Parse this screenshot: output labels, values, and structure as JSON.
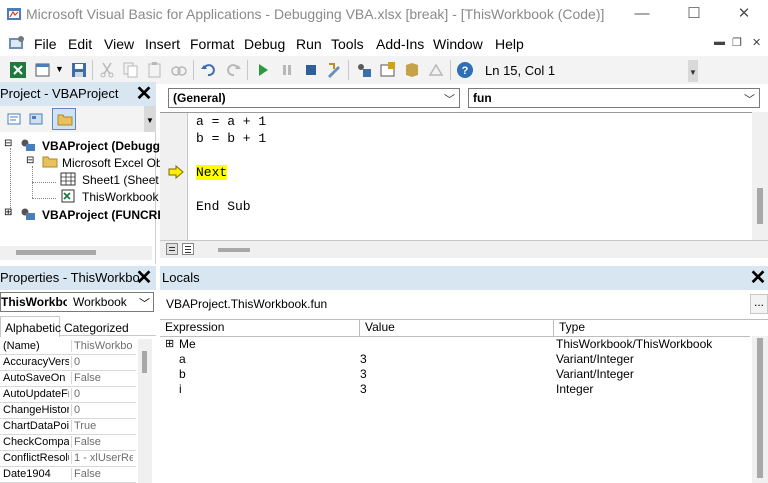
{
  "titlebar": {
    "title": "Microsoft Visual Basic for Applications - Debugging VBA.xlsx [break] - [ThisWorkbook (Code)]",
    "minimize": "—",
    "maximize": "☐",
    "close": "✕"
  },
  "menubar": {
    "items": [
      "File",
      "Edit",
      "View",
      "Insert",
      "Format",
      "Debug",
      "Run",
      "Tools",
      "Add-Ins",
      "Window",
      "Help"
    ],
    "mdi_minimize": "▬",
    "mdi_restore": "❐",
    "mdi_close": "✕"
  },
  "toolbar": {
    "position": "Ln 15, Col 1"
  },
  "project": {
    "title": "Project - VBAProject",
    "tree": [
      {
        "label": "VBAProject (Debugg",
        "bold": true,
        "expander": "⊟"
      },
      {
        "label": "Microsoft Excel Obj",
        "bold": false,
        "expander": "⊟"
      },
      {
        "label": "Sheet1 (Sheet",
        "bold": false
      },
      {
        "label": "ThisWorkbook",
        "bold": false
      },
      {
        "label": "VBAProject (FUNCRE",
        "bold": true,
        "expander": "⊞"
      }
    ]
  },
  "code": {
    "object_combo": "(General)",
    "proc_combo": "fun",
    "lines": [
      "a = a + 1",
      "b = b + 1",
      "",
      "Next",
      "",
      "End Sub"
    ],
    "current_line_arrow": "⇨"
  },
  "properties": {
    "title": "Properties - ThisWorkbo",
    "object_name": "ThisWorkbo",
    "object_type": "Workbook",
    "tab_alphabetic": "Alphabetic",
    "tab_categorized": "Categorized",
    "rows": [
      {
        "name": "(Name)",
        "value": "ThisWorkbo"
      },
      {
        "name": "AccuracyVers",
        "value": "0"
      },
      {
        "name": "AutoSaveOn",
        "value": "False"
      },
      {
        "name": "AutoUpdateFr",
        "value": "0"
      },
      {
        "name": "ChangeHistor",
        "value": "0"
      },
      {
        "name": "ChartDataPoir",
        "value": "True"
      },
      {
        "name": "CheckCompat",
        "value": "False"
      },
      {
        "name": "ConflictResolu",
        "value": "1 - xlUserRe"
      },
      {
        "name": "Date1904",
        "value": "False"
      }
    ]
  },
  "locals": {
    "title": "Locals",
    "context": "VBAProject.ThisWorkbook.fun",
    "ellipsis": "...",
    "headers": [
      "Expression",
      "Value",
      "Type"
    ],
    "rows": [
      {
        "expander": "⊞",
        "expression": "Me",
        "value": "",
        "type": "ThisWorkbook/ThisWorkbook"
      },
      {
        "expander": "",
        "expression": "a",
        "value": "3",
        "type": "Variant/Integer"
      },
      {
        "expander": "",
        "expression": "b",
        "value": "3",
        "type": "Variant/Integer"
      },
      {
        "expander": "",
        "expression": "i",
        "value": "3",
        "type": "Integer"
      }
    ]
  },
  "colors": {
    "panel_header": "#d8e6f2",
    "highlight": "#ffff00",
    "arrow": "#f0c800"
  }
}
